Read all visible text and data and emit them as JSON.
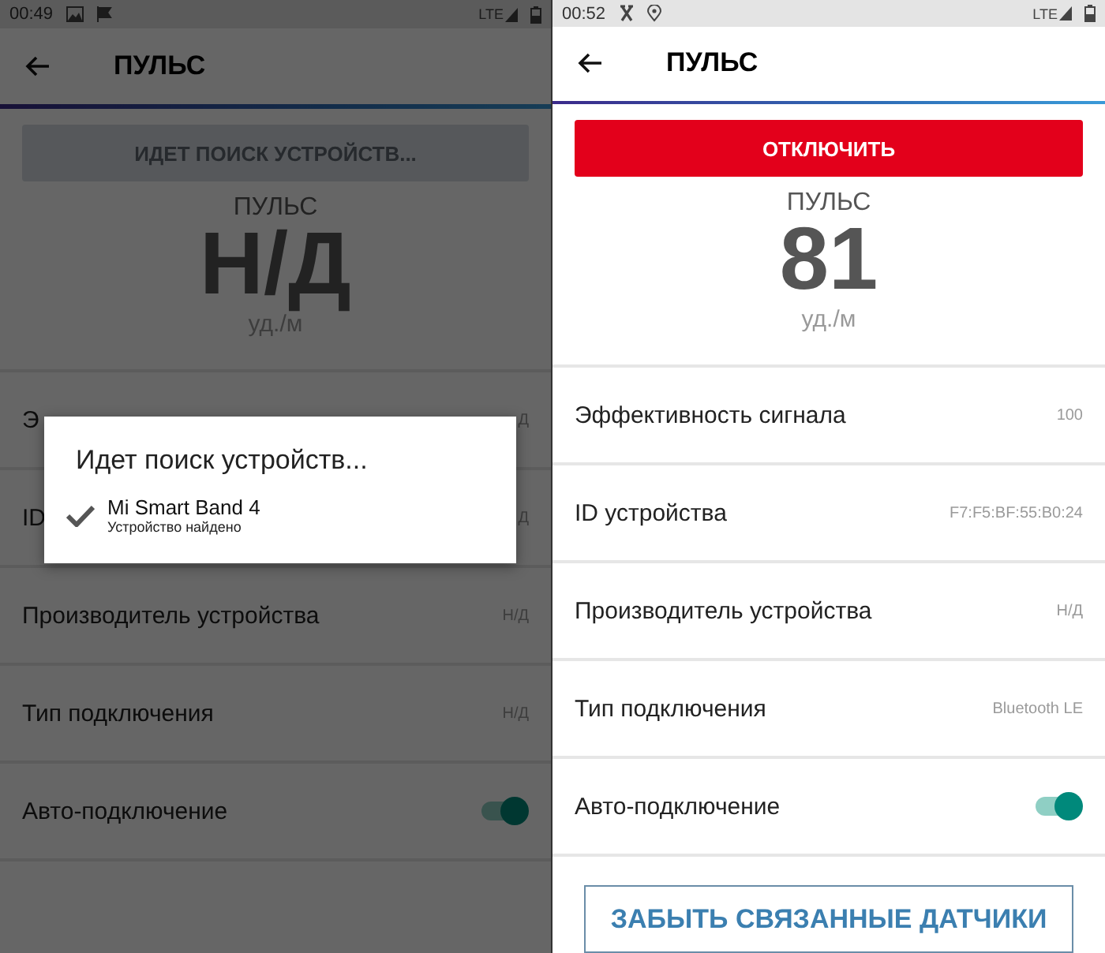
{
  "screens": [
    {
      "status_bar": {
        "time": "00:49",
        "network": "LTE"
      },
      "title": "ПУЛЬС",
      "action_button": {
        "label": "ИДЕТ ПОИСК УСТРОЙСТВ...",
        "kind": "searching",
        "disabled": true
      },
      "reading": {
        "label": "ПУЛЬС",
        "value": "Н/Д",
        "unit": "уд./м"
      },
      "rows": [
        {
          "kind": "value",
          "label": "Э",
          "value": "Д"
        },
        {
          "kind": "value",
          "label": "ID",
          "value": "Д"
        },
        {
          "kind": "value",
          "label": "Производитель устройства",
          "value": "Н/Д"
        },
        {
          "kind": "value",
          "label": "Тип подключения",
          "value": "Н/Д"
        },
        {
          "kind": "toggle",
          "label": "Авто-подключение",
          "on": true
        }
      ],
      "dialog": {
        "title": "Идет поиск устройств...",
        "item": {
          "name": "Mi Smart Band 4",
          "status": "Устройство найдено",
          "checked": true
        }
      }
    },
    {
      "status_bar": {
        "time": "00:52",
        "network": "LTE"
      },
      "title": "ПУЛЬС",
      "action_button": {
        "label": "ОТКЛЮЧИТЬ",
        "kind": "disconnect",
        "disabled": false
      },
      "reading": {
        "label": "ПУЛЬС",
        "value": "81",
        "unit": "уд./м"
      },
      "rows": [
        {
          "kind": "value",
          "label": "Эффективность сигнала",
          "value": "100"
        },
        {
          "kind": "value",
          "label": "ID устройства",
          "value": "F7:F5:BF:55:B0:24"
        },
        {
          "kind": "value",
          "label": "Производитель устройства",
          "value": "Н/Д"
        },
        {
          "kind": "value",
          "label": "Тип подключения",
          "value": "Bluetooth LE"
        },
        {
          "kind": "toggle",
          "label": "Авто-подключение",
          "on": true
        }
      ],
      "forget_button": {
        "label": "ЗАБЫТЬ СВЯЗАННЫЕ ДАТЧИКИ"
      }
    }
  ]
}
